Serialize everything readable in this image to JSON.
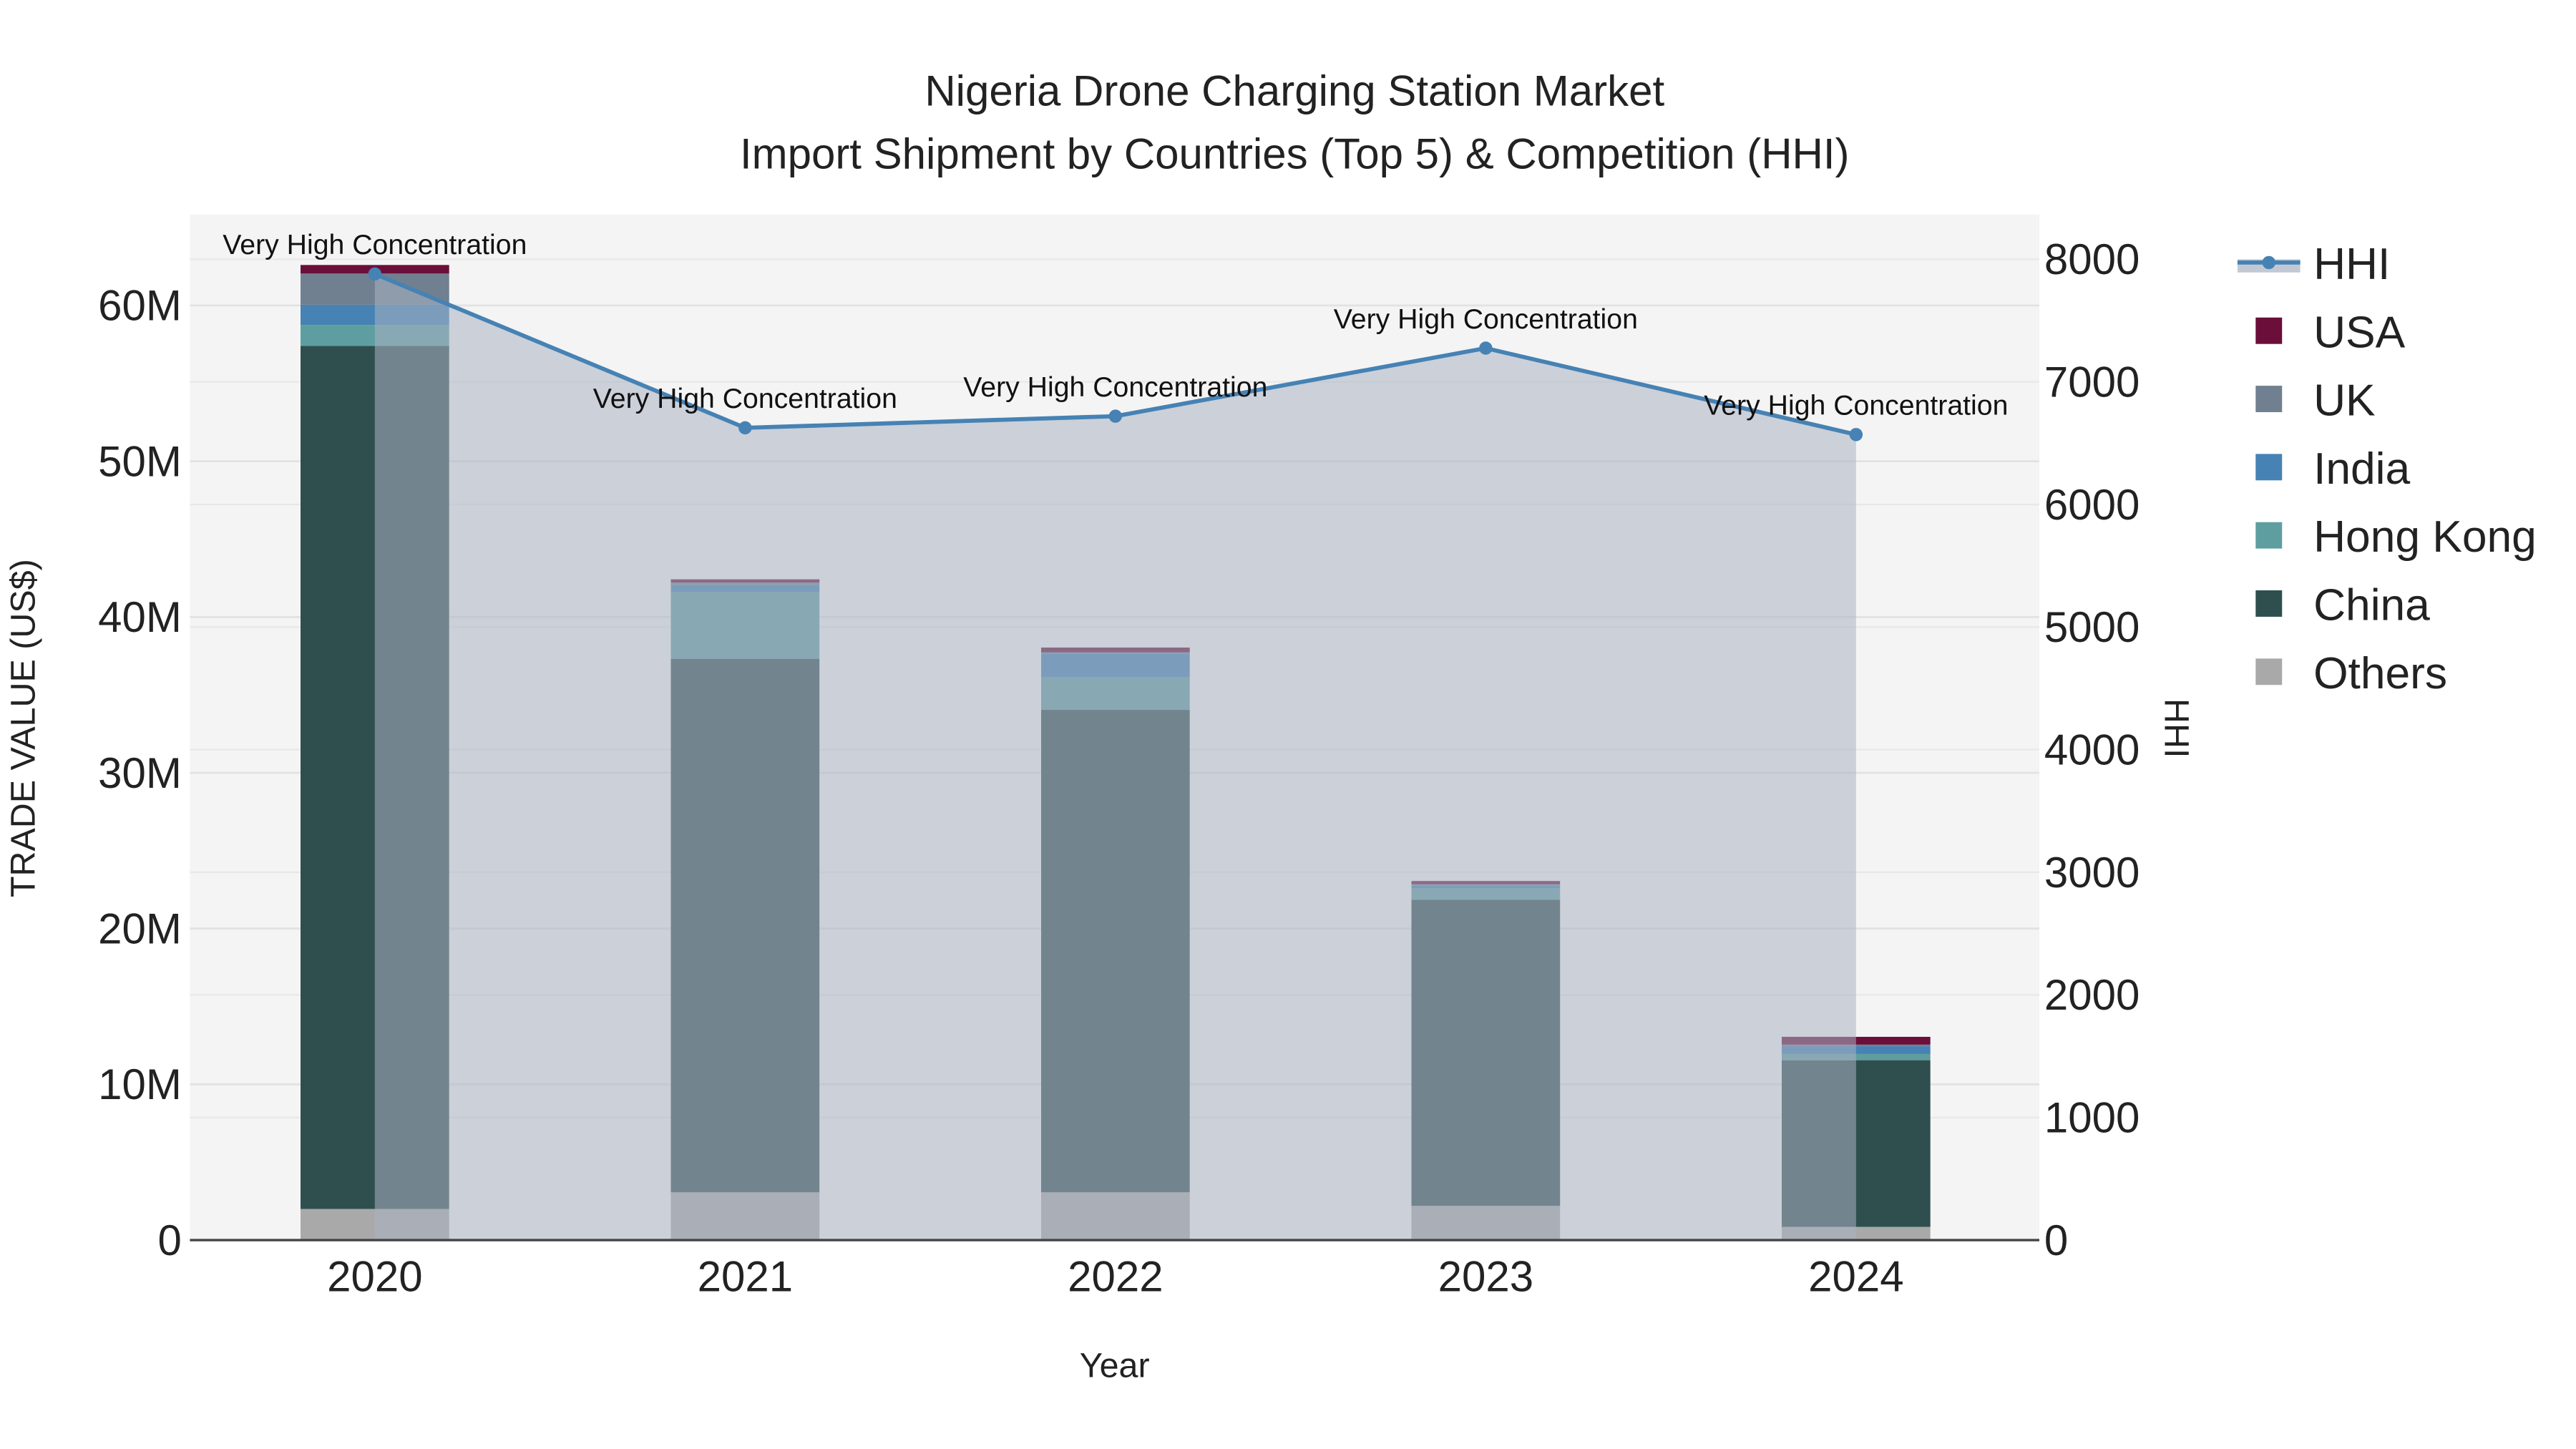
{
  "chart_data": {
    "type": "bar",
    "title": "Nigeria Drone Charging Station Market",
    "subtitle": "Import Shipment by Countries (Top 5) & Competition (HHI)",
    "xlabel": "Year",
    "ylabel": "TRADE VALUE (US$)",
    "y2label": "HHI",
    "categories": [
      "2020",
      "2021",
      "2022",
      "2023",
      "2024"
    ],
    "ylim": [
      0,
      65000000
    ],
    "y2lim": [
      0,
      8300
    ],
    "yticks": [
      0,
      10000000,
      20000000,
      30000000,
      40000000,
      50000000,
      60000000
    ],
    "ytick_labels": [
      "0",
      "10M",
      "20M",
      "30M",
      "40M",
      "50M",
      "60M"
    ],
    "y2ticks": [
      0,
      1000,
      2000,
      3000,
      4000,
      5000,
      6000,
      7000,
      8000
    ],
    "y2tick_labels": [
      "0",
      "1000",
      "2000",
      "3000",
      "4000",
      "5000",
      "6000",
      "7000",
      "8000"
    ],
    "grid": true,
    "legend_position": "right",
    "series": [
      {
        "name": "Others",
        "color": "#A9A9A9",
        "values": [
          2000000,
          3070000,
          3070000,
          2200000,
          850000
        ]
      },
      {
        "name": "China",
        "color": "#2F4F4F",
        "values": [
          55400000,
          34250000,
          30970000,
          19650000,
          10700000
        ]
      },
      {
        "name": "Hong Kong",
        "color": "#5F9EA0",
        "values": [
          1350000,
          4300000,
          2100000,
          750000,
          400000
        ]
      },
      {
        "name": "India",
        "color": "#4682B4",
        "values": [
          1300000,
          450000,
          1500000,
          150000,
          500000
        ]
      },
      {
        "name": "UK",
        "color": "#708090",
        "values": [
          2000000,
          150000,
          100000,
          100000,
          100000
        ]
      },
      {
        "name": "USA",
        "color": "#6B0F3A",
        "values": [
          550000,
          200000,
          300000,
          200000,
          500000
        ]
      }
    ],
    "line_series": {
      "name": "HHI",
      "color": "#4682B4",
      "axis": "right",
      "values": [
        7880,
        6625,
        6720,
        7275,
        6570
      ]
    },
    "annotations": [
      "Very High Concentration",
      "Very High Concentration",
      "Very High Concentration",
      "Very High Concentration",
      "Very High Concentration"
    ],
    "legend_order": [
      "HHI",
      "USA",
      "UK",
      "India",
      "Hong Kong",
      "China",
      "Others"
    ]
  }
}
